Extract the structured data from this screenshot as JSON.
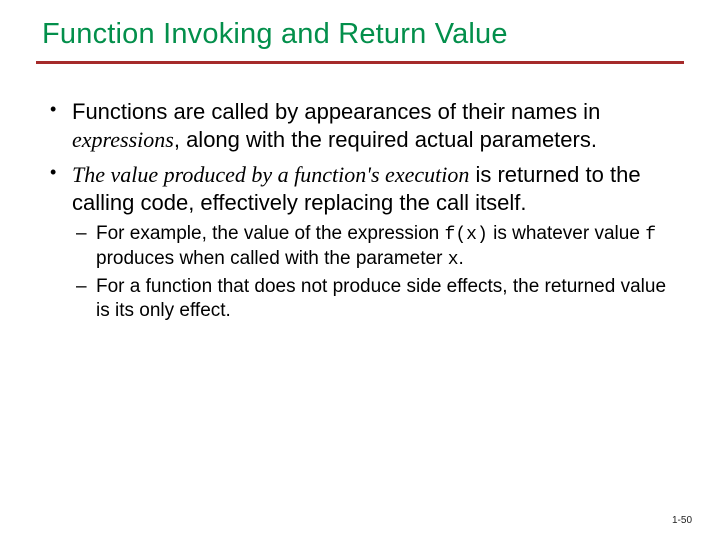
{
  "title": "Function Invoking and Return Value",
  "bullets": [
    {
      "pre": "Functions are called by appearances of their names in ",
      "em": "expressions",
      "post": ", along with the required actual parameters."
    },
    {
      "em_pre": "The value produced by a function's execution",
      "post": " is returned to the calling code, effectively replacing the call itself.",
      "sub": [
        {
          "t0": "For example, the value of the expression ",
          "c0": "f(x)",
          "t1": " is whatever value ",
          "c1": "f",
          "t2": " produces when called with the parameter ",
          "c2": "x",
          "t3": "."
        },
        {
          "t0": "For a function that does not produce side effects, the returned value is its only effect."
        }
      ]
    }
  ],
  "page": "1-50"
}
